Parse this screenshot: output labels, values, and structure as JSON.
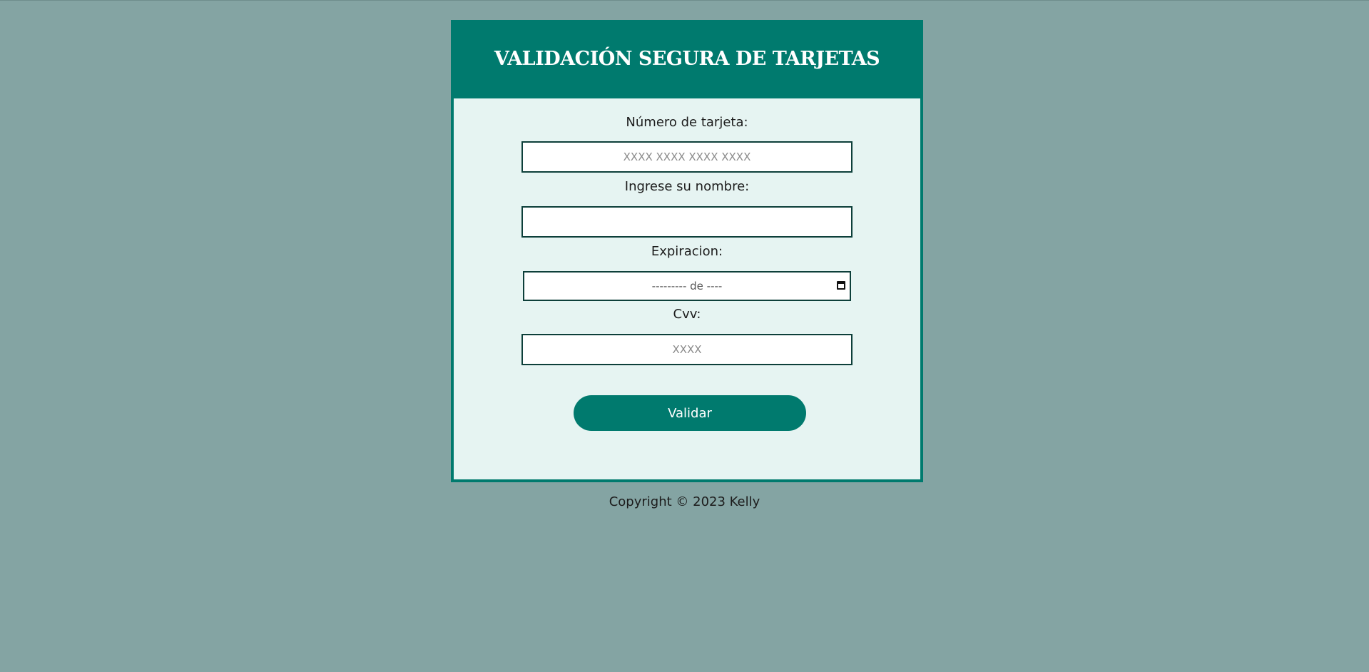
{
  "form": {
    "title": "VALIDACIÓN SEGURA DE TARJETAS",
    "card_number": {
      "label": "Número de tarjeta:",
      "value": "",
      "placeholder": "XXXX XXXX XXXX XXXX"
    },
    "name": {
      "label": "Ingrese su nombre:",
      "value": "",
      "placeholder": ""
    },
    "expiration": {
      "label": "Expiracion:",
      "display": "--------- de ----",
      "icon": "calendar-icon"
    },
    "cvv": {
      "label": "Cvv:",
      "value": "",
      "placeholder": "XXXX"
    },
    "submit_label": "Validar"
  },
  "footer": {
    "text": "Copyright © 2023 Kelly"
  },
  "colors": {
    "background": "#84a4a3",
    "accent": "#007a6e",
    "card_body": "#e6f4f2",
    "input_border": "#0d3f3a"
  }
}
